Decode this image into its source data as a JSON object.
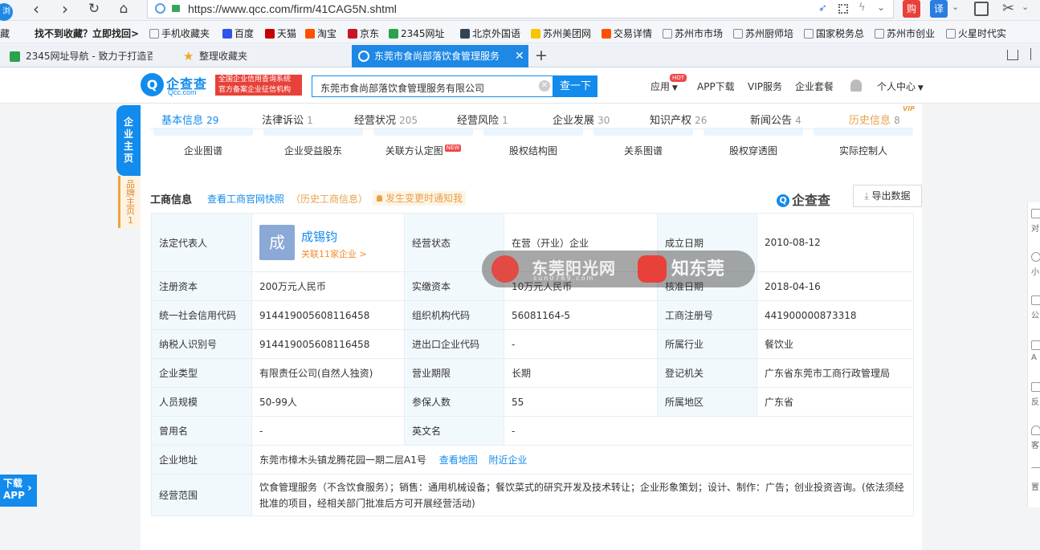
{
  "browser": {
    "url": "https://www.qcc.com/firm/41CAG5N.shtml",
    "search_engine_badge": "译",
    "bookmarks": [
      {
        "label": "藏"
      },
      {
        "label": "找不到收藏？立即找回>"
      },
      {
        "label": "手机收藏夹"
      },
      {
        "label": "百度"
      },
      {
        "label": "天猫"
      },
      {
        "label": "淘宝"
      },
      {
        "label": "京东"
      },
      {
        "label": "2345网址"
      },
      {
        "label": "北京外国语"
      },
      {
        "label": "苏州美团网"
      },
      {
        "label": "交易详情"
      },
      {
        "label": "苏州市市场"
      },
      {
        "label": "苏州厨师培"
      },
      {
        "label": "国家税务总"
      },
      {
        "label": "苏州市创业"
      },
      {
        "label": "火星时代实"
      }
    ],
    "tabs": [
      {
        "label": "2345网址导航 - 致力于打造百"
      },
      {
        "label": "整理收藏夹"
      },
      {
        "label": "东莞市食尚部落饮食管理服务"
      }
    ]
  },
  "site": {
    "logo_text": "企查查",
    "logo_sub": "Qcc.com",
    "badge_line1": "全国企业信用查询系统",
    "badge_line2": "官方备案企业征信机构",
    "search_value": "东莞市食尚部落饮食管理服务有限公司",
    "search_button": "查一下",
    "nav": [
      {
        "label": "应用"
      },
      {
        "label": "APP下载"
      },
      {
        "label": "VIP服务"
      },
      {
        "label": "企业套餐"
      },
      {
        "label": "个人中心"
      }
    ],
    "hot_tag": "HOT"
  },
  "sidebar": {
    "main": "企业主页",
    "brand": "品牌主页",
    "brand_count": "1"
  },
  "main_tabs": [
    {
      "label": "基本信息",
      "count": "29"
    },
    {
      "label": "法律诉讼",
      "count": "1"
    },
    {
      "label": "经营状况",
      "count": "205"
    },
    {
      "label": "经营风险",
      "count": "1"
    },
    {
      "label": "企业发展",
      "count": "30"
    },
    {
      "label": "知识产权",
      "count": "26"
    },
    {
      "label": "新闻公告",
      "count": "4"
    },
    {
      "label": "历史信息",
      "count": "8"
    }
  ],
  "vip_tag": "VIP",
  "graphs": [
    {
      "label": "企业图谱"
    },
    {
      "label": "企业受益股东"
    },
    {
      "label": "关联方认定图"
    },
    {
      "label": "股权结构图"
    },
    {
      "label": "关系图谱"
    },
    {
      "label": "股权穿透图"
    },
    {
      "label": "实际控制人"
    }
  ],
  "new_tag": "NEW",
  "section": {
    "title": "工商信息",
    "link_snapshot": "查看工商官网快照",
    "link_history": "（历史工商信息）",
    "notify": "发生变更时通知我",
    "brand": "企查查",
    "export": "导出数据"
  },
  "info": {
    "legal_rep_label": "法定代表人",
    "legal_rep_avatar": "成",
    "legal_rep_name": "成锡钧",
    "legal_rep_related": "关联11家企业 >",
    "status_label": "经营状态",
    "status_value": "在营（开业）企业",
    "founded_label": "成立日期",
    "founded_value": "2010-08-12",
    "reg_capital_label": "注册资本",
    "reg_capital_value": "200万元人民币",
    "paid_capital_label": "实缴资本",
    "paid_capital_value": "10万元人民币",
    "approval_label": "核准日期",
    "approval_value": "2018-04-16",
    "credit_code_label": "统一社会信用代码",
    "credit_code_value": "914419005608116458",
    "org_code_label": "组织机构代码",
    "org_code_value": "56081164-5",
    "reg_no_label": "工商注册号",
    "reg_no_value": "441900000873318",
    "taxpayer_label": "纳税人识别号",
    "taxpayer_value": "914419005608116458",
    "import_export_label": "进出口企业代码",
    "import_export_value": "-",
    "industry_label": "所属行业",
    "industry_value": "餐饮业",
    "type_label": "企业类型",
    "type_value": "有限责任公司(自然人独资)",
    "term_label": "营业期限",
    "term_value": "长期",
    "authority_label": "登记机关",
    "authority_value": "广东省东莞市工商行政管理局",
    "staff_label": "人员规模",
    "staff_value": "50-99人",
    "insured_label": "参保人数",
    "insured_value": "55",
    "region_label": "所属地区",
    "region_value": "广东省",
    "former_name_label": "曾用名",
    "former_name_value": "-",
    "english_name_label": "英文名",
    "english_name_value": "-",
    "address_label": "企业地址",
    "address_value": "东莞市樟木头镇龙腾花园一期二层A1号",
    "address_map": "查看地图",
    "address_nearby": "附近企业",
    "scope_label": "经营范围",
    "scope_value": "饮食管理服务（不含饮食服务）；销售：通用机械设备；餐饮菜式的研究开发及技术转让；企业形象策划；设计、制作：广告；创业投资咨询。(依法须经批准的项目，经相关部门批准后方可开展经营活动)"
  },
  "watermark": {
    "left_text": "东莞阳光网",
    "left_sub": "sun0769.com",
    "right_text": "知东莞"
  },
  "download_app": {
    "line1": "下载",
    "line2": "APP"
  },
  "right_sidebar": [
    "对",
    "小",
    "公",
    "A",
    "反",
    "客",
    "置"
  ]
}
